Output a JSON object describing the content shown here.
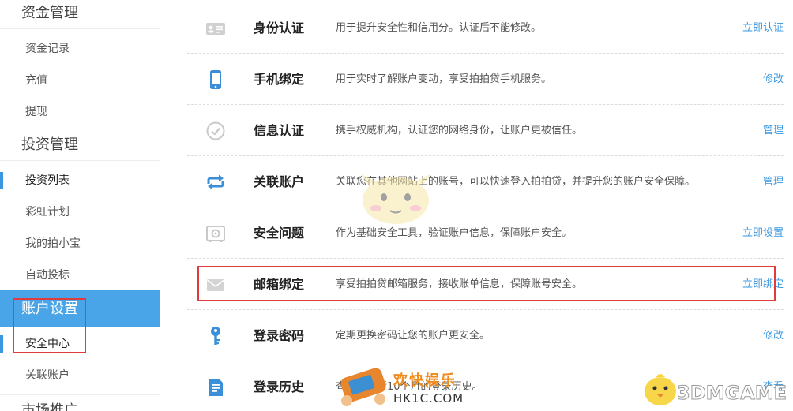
{
  "sidebar": {
    "groups": [
      {
        "title": "资金管理",
        "items": [
          "资金记录",
          "充值",
          "提现"
        ]
      },
      {
        "title": "投资管理",
        "items": [
          "投资列表",
          "彩虹计划",
          "我的拍小宝",
          "自动投标"
        ]
      },
      {
        "title": "账户设置",
        "items": [
          "安全中心",
          "关联账户"
        ]
      },
      {
        "title": "市场推广",
        "items": []
      }
    ]
  },
  "rows": [
    {
      "title": "身份认证",
      "desc": "用于提升安全性和信用分。认证后不能修改。",
      "action": "立即认证",
      "icon": "id-card-icon"
    },
    {
      "title": "手机绑定",
      "desc": "用于实时了解账户变动，享受拍拍贷手机服务。",
      "action": "修改",
      "icon": "phone-icon"
    },
    {
      "title": "信息认证",
      "desc": "携手权威机构，认证您的网络身份，让账户更被信任。",
      "action": "管理",
      "icon": "check-circle-icon"
    },
    {
      "title": "关联账户",
      "desc": "关联您在其他网站上的账号，可以快速登入拍拍贷，并提升您的账户安全保障。",
      "action": "管理",
      "icon": "link-arrows-icon"
    },
    {
      "title": "安全问题",
      "desc": "作为基础安全工具，验证账户信息，保障账户安全。",
      "action": "立即设置",
      "icon": "safe-icon"
    },
    {
      "title": "邮箱绑定",
      "desc": "享受拍拍贷邮箱服务，接收账单信息，保障账号安全。",
      "action": "立即绑定",
      "icon": "mail-icon"
    },
    {
      "title": "登录密码",
      "desc": "定期更换密码让您的账户更安全。",
      "action": "修改",
      "icon": "key-icon"
    },
    {
      "title": "登录历史",
      "desc": "查看您最近10个月的登录历史。",
      "action": "查看",
      "icon": "document-icon"
    }
  ],
  "watermarks": {
    "site_cn": "欢快娱乐",
    "site_url": "HK1C.COM",
    "brand": "3DMGAME"
  },
  "colors": {
    "accent": "#3a97e0",
    "sidebar_active": "#4aa5e8",
    "highlight": "#e03a3a",
    "icon": "#3a8fd8"
  }
}
